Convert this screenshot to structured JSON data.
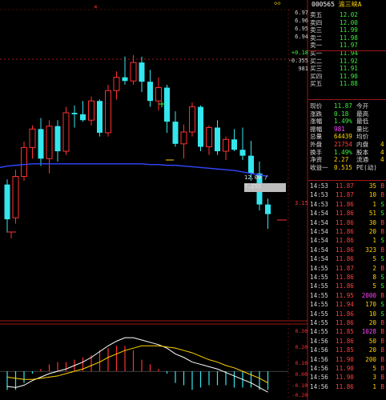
{
  "stock": {
    "code": "000565",
    "name": "渝三峡A"
  },
  "top_marker": "×",
  "corner_icon": "◇◇",
  "left_price_labels": [
    "6.97",
    "6.96",
    "6.95",
    "6.94",
    "+0.18",
    "-0.355",
    "981"
  ],
  "order_book": [
    {
      "label": "卖五",
      "price": "12.02",
      "vol": ""
    },
    {
      "label": "卖四",
      "price": "12.00",
      "vol": ""
    },
    {
      "label": "卖三",
      "price": "11.99",
      "vol": ""
    },
    {
      "label": "卖二",
      "price": "11.98",
      "vol": ""
    },
    {
      "label": "卖一",
      "price": "11.97",
      "vol": ""
    },
    {
      "label": "买一",
      "price": "11.94",
      "vol": ""
    },
    {
      "label": "买二",
      "price": "11.92",
      "vol": ""
    },
    {
      "label": "买三",
      "price": "11.91",
      "vol": ""
    },
    {
      "label": "买四",
      "price": "11.90",
      "vol": ""
    },
    {
      "label": "买五",
      "price": "11.88",
      "vol": ""
    }
  ],
  "quote_rows": [
    {
      "label": "现价",
      "value": "11.87",
      "label2": "今开",
      "value2": ""
    },
    {
      "label": "涨跌",
      "value": "0.18",
      "label2": "最高",
      "value2": ""
    },
    {
      "label": "涨幅",
      "value": "1.49%",
      "label2": "最低",
      "value2": ""
    },
    {
      "label": "振幅",
      "value": "981",
      "label2": "量比",
      "value2": ""
    },
    {
      "label": "总量",
      "value": "64439",
      "label2": "均价",
      "value2": ""
    },
    {
      "label": "外盘",
      "value": "21754",
      "label2": "内盘",
      "value2": "4"
    },
    {
      "label": "换手",
      "value": "1.49%",
      "label2": "股本",
      "value2": "4"
    },
    {
      "label": "净资",
      "value": "2.27",
      "label2": "流通",
      "value2": "4"
    },
    {
      "label": "收益一",
      "value": "0.515",
      "label2": "PE(动)",
      "value2": ""
    }
  ],
  "ticks": [
    {
      "time": "14:53",
      "price": "11.87",
      "vol": "35",
      "dir": "B"
    },
    {
      "time": "14:53",
      "price": "11.87",
      "vol": "10",
      "dir": "B"
    },
    {
      "time": "14:53",
      "price": "11.86",
      "vol": "1",
      "dir": "S"
    },
    {
      "time": "14:54",
      "price": "11.86",
      "vol": "51",
      "dir": "S"
    },
    {
      "time": "14:54",
      "price": "11.86",
      "vol": "30",
      "dir": "B"
    },
    {
      "time": "14:54",
      "price": "11.86",
      "vol": "20",
      "dir": "B"
    },
    {
      "time": "14:54",
      "price": "11.86",
      "vol": "1",
      "dir": "S"
    },
    {
      "time": "14:54",
      "price": "11.86",
      "vol": "323",
      "dir": "B"
    },
    {
      "time": "14:54",
      "price": "11.86",
      "vol": "5",
      "dir": "S"
    },
    {
      "time": "14:55",
      "price": "11.87",
      "vol": "2",
      "dir": "B"
    },
    {
      "time": "14:55",
      "price": "11.86",
      "vol": "8",
      "dir": "S"
    },
    {
      "time": "14:55",
      "price": "11.86",
      "vol": "5",
      "dir": "S"
    },
    {
      "time": "14:55",
      "price": "11.95",
      "vol": "2000",
      "dir": "B"
    },
    {
      "time": "14:55",
      "price": "11.94",
      "vol": "170",
      "dir": "S"
    },
    {
      "time": "14:55",
      "price": "11.86",
      "vol": "10",
      "dir": "S"
    },
    {
      "time": "14:55",
      "price": "11.86",
      "vol": "20",
      "dir": "B"
    },
    {
      "time": "14:55",
      "price": "11.85",
      "vol": "1028",
      "dir": "B"
    },
    {
      "time": "14:56",
      "price": "11.86",
      "vol": "50",
      "dir": "B"
    },
    {
      "time": "14:56",
      "price": "11.85",
      "vol": "20",
      "dir": "B"
    },
    {
      "time": "14:56",
      "price": "11.90",
      "vol": "200",
      "dir": "B"
    },
    {
      "time": "14:56",
      "price": "11.90",
      "vol": "5",
      "dir": "B"
    },
    {
      "time": "14:56",
      "price": "11.90",
      "vol": "3",
      "dir": "B"
    },
    {
      "time": "14:56",
      "price": "11.86",
      "vol": "1",
      "dir": "B"
    }
  ],
  "crosshair_readout": "12.00 / 7.255",
  "osc_labels": [
    "0.30",
    "0.20",
    "0.10",
    "0.00",
    "-0.10",
    "-0.20"
  ],
  "small_label_price": "3.15",
  "chart_data": {
    "type": "candlestick",
    "candles": [
      {
        "o": 7.05,
        "h": 7.12,
        "l": 6.4,
        "c": 6.58
      },
      {
        "o": 6.6,
        "h": 7.25,
        "l": 6.52,
        "c": 7.16
      },
      {
        "o": 7.16,
        "h": 7.63,
        "l": 7.1,
        "c": 7.55
      },
      {
        "o": 7.55,
        "h": 7.85,
        "l": 7.4,
        "c": 7.8
      },
      {
        "o": 7.8,
        "h": 7.95,
        "l": 7.3,
        "c": 7.4
      },
      {
        "o": 7.4,
        "h": 7.92,
        "l": 7.2,
        "c": 7.84
      },
      {
        "o": 7.84,
        "h": 7.92,
        "l": 7.36,
        "c": 7.5
      },
      {
        "o": 7.5,
        "h": 8.1,
        "l": 7.45,
        "c": 8.02
      },
      {
        "o": 8.02,
        "h": 8.12,
        "l": 7.82,
        "c": 8.0
      },
      {
        "o": 8.0,
        "h": 8.18,
        "l": 7.9,
        "c": 7.92
      },
      {
        "o": 7.92,
        "h": 8.24,
        "l": 7.85,
        "c": 8.18
      },
      {
        "o": 8.18,
        "h": 8.2,
        "l": 7.7,
        "c": 7.75
      },
      {
        "o": 7.75,
        "h": 8.4,
        "l": 7.7,
        "c": 8.32
      },
      {
        "o": 8.32,
        "h": 8.58,
        "l": 8.2,
        "c": 8.5
      },
      {
        "o": 8.5,
        "h": 8.78,
        "l": 8.4,
        "c": 8.45
      },
      {
        "o": 8.45,
        "h": 8.8,
        "l": 8.4,
        "c": 8.7
      },
      {
        "o": 8.7,
        "h": 8.78,
        "l": 8.3,
        "c": 8.44
      },
      {
        "o": 8.44,
        "h": 8.6,
        "l": 8.1,
        "c": 8.18
      },
      {
        "o": 8.18,
        "h": 8.5,
        "l": 8.05,
        "c": 8.36
      },
      {
        "o": 8.36,
        "h": 8.4,
        "l": 7.75,
        "c": 7.9
      },
      {
        "o": 7.9,
        "h": 8.04,
        "l": 7.56,
        "c": 7.6
      },
      {
        "o": 7.6,
        "h": 7.86,
        "l": 7.4,
        "c": 7.76
      },
      {
        "o": 7.76,
        "h": 8.16,
        "l": 7.7,
        "c": 8.1
      },
      {
        "o": 8.1,
        "h": 8.12,
        "l": 7.5,
        "c": 7.56
      },
      {
        "o": 7.56,
        "h": 7.85,
        "l": 7.45,
        "c": 7.82
      },
      {
        "o": 7.82,
        "h": 7.92,
        "l": 7.45,
        "c": 7.5
      },
      {
        "o": 7.5,
        "h": 7.7,
        "l": 7.38,
        "c": 7.66
      },
      {
        "o": 7.66,
        "h": 7.8,
        "l": 7.5,
        "c": 7.52
      },
      {
        "o": 7.52,
        "h": 7.82,
        "l": 7.38,
        "c": 7.44
      },
      {
        "o": 7.44,
        "h": 7.64,
        "l": 7.1,
        "c": 7.2
      },
      {
        "o": 7.2,
        "h": 7.36,
        "l": 6.7,
        "c": 6.78
      },
      {
        "o": 6.78,
        "h": 6.86,
        "l": 6.45,
        "c": 6.65
      }
    ],
    "ma_line": [
      7.3,
      7.31,
      7.32,
      7.33,
      7.33,
      7.33,
      7.33,
      7.33,
      7.33,
      7.33,
      7.33,
      7.33,
      7.33,
      7.33,
      7.33,
      7.33,
      7.33,
      7.32,
      7.32,
      7.31,
      7.31,
      7.3,
      7.29,
      7.28,
      7.27,
      7.26,
      7.25,
      7.24,
      7.22,
      7.2,
      7.18,
      7.16
    ],
    "ylim": [
      6.3,
      8.95
    ],
    "osc_dif": [
      -0.13,
      -0.14,
      -0.12,
      -0.08,
      -0.05,
      -0.02,
      0.0,
      0.02,
      0.05,
      0.08,
      0.12,
      0.17,
      0.22,
      0.26,
      0.29,
      0.29,
      0.27,
      0.25,
      0.23,
      0.2,
      0.15,
      0.12,
      0.08,
      0.06,
      0.04,
      0.02,
      -0.01,
      -0.04,
      -0.07,
      -0.1,
      -0.14,
      -0.18
    ],
    "osc_dea": [
      -0.05,
      -0.06,
      -0.07,
      -0.07,
      -0.06,
      -0.05,
      -0.04,
      -0.02,
      0.0,
      0.02,
      0.05,
      0.08,
      0.12,
      0.15,
      0.18,
      0.2,
      0.22,
      0.22,
      0.22,
      0.21,
      0.2,
      0.18,
      0.16,
      0.13,
      0.1,
      0.08,
      0.05,
      0.03,
      0.0,
      -0.03,
      -0.06,
      -0.1
    ],
    "osc_ylim": [
      -0.22,
      0.36
    ]
  },
  "colors": {
    "up": "#ff3030",
    "down": "#34e6ee",
    "ma": "#3246ff",
    "text_red": "#ff4040",
    "text_yellow": "#ffd400",
    "text_green": "#3cf03c",
    "text_magenta": "#ff44ff",
    "grid": "#a01818"
  }
}
